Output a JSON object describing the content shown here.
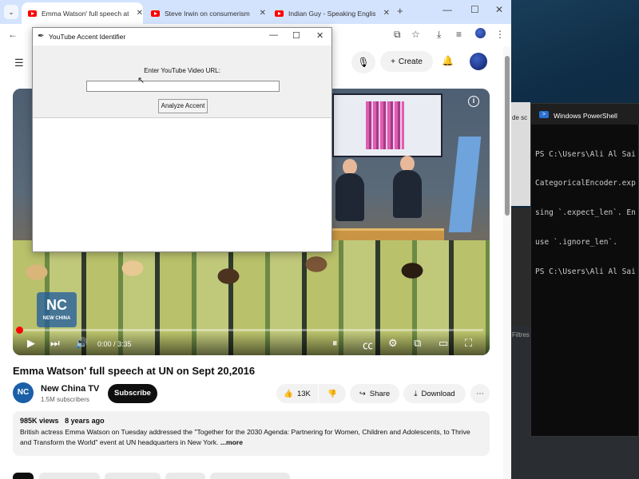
{
  "browser": {
    "tabs": [
      {
        "title": "Emma Watson' full speech at U",
        "active": true
      },
      {
        "title": "Steve Irwin on consumerism ar",
        "active": false
      },
      {
        "title": "Indian Guy - Speaking English",
        "active": false
      }
    ]
  },
  "youtube": {
    "create_label": "Create",
    "video": {
      "time": "0:00 / 3:35",
      "logo_text": "NEW CHINA",
      "logo_mark": "NC",
      "progress_fraction": 0
    },
    "title": "Emma Watson' full speech at UN on Sept 20,2016",
    "channel": {
      "name": "New China TV",
      "subscribers": "1.5M subscribers",
      "logo": "NC"
    },
    "subscribe_label": "Subscribe",
    "likes": "13K",
    "share_label": "Share",
    "download_label": "Download",
    "description": {
      "views": "985K views",
      "age": "8 years ago",
      "text": "British actress Emma Watson on Tuesday addressed the \"Together for the 2030 Agenda: Partnering for Women, Children and Adolescents, to Thrive and Transform the World\" event at UN headquarters in New York.",
      "more": "...more"
    }
  },
  "dialog": {
    "title": "YouTube Accent Identifier",
    "label": "Enter YouTube Video URL:",
    "url_value": "",
    "button_label": "Analyze Accent"
  },
  "powershell": {
    "title": "Windows PowerShell",
    "lines": [
      "PS C:\\Users\\Ali Al Sai",
      "CategoricalEncoder.exp",
      "sing `.expect_len`. En",
      "use `.ignore_len`.",
      "PS C:\\Users\\Ali Al Sai"
    ]
  },
  "desktop_fragments": {
    "filter_text": "Filtres",
    "side_label": "de sc"
  },
  "colors": {
    "youtube_red": "#ff0000",
    "tabstrip": "#d3e3fd",
    "powershell_bg": "#0c0c0c"
  }
}
